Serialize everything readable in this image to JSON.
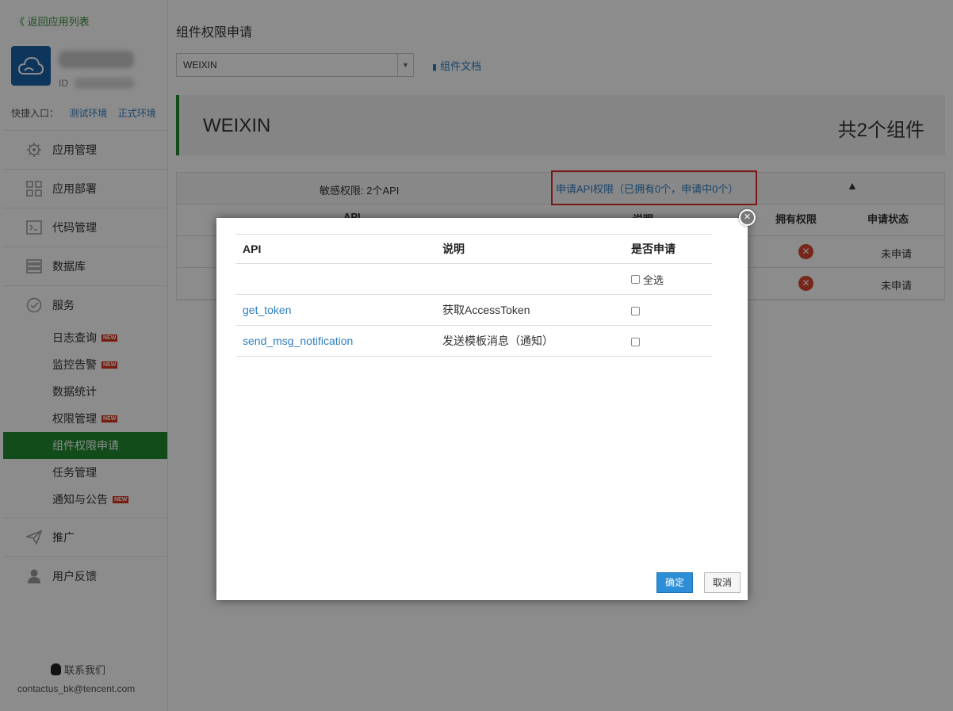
{
  "sidebar": {
    "back_label": "《 返回应用列表",
    "app_id_label": "ID",
    "quick_entry_label": "快捷入口：",
    "quick_links": [
      "测试环境",
      "正式环境"
    ],
    "menu": [
      {
        "label": "应用管理",
        "icon": "gear-icon"
      },
      {
        "label": "应用部署",
        "icon": "grid-icon"
      },
      {
        "label": "代码管理",
        "icon": "terminal-icon"
      },
      {
        "label": "数据库",
        "icon": "database-icon"
      },
      {
        "label": "服务",
        "icon": "check-circle-icon"
      }
    ],
    "service_items": [
      {
        "label": "日志查询",
        "new": true
      },
      {
        "label": "监控告警",
        "new": true
      },
      {
        "label": "数据统计",
        "new": false
      },
      {
        "label": "权限管理",
        "new": true
      },
      {
        "label": "组件权限申请",
        "new": false,
        "active": true
      },
      {
        "label": "任务管理",
        "new": false
      },
      {
        "label": "通知与公告",
        "new": true
      }
    ],
    "menu_bottom": [
      {
        "label": "推广",
        "icon": "paper-plane-icon"
      },
      {
        "label": "用户反馈",
        "icon": "user-icon"
      }
    ],
    "new_badge": "NEW",
    "contact_label": "联系我们",
    "contact_email": "contactus_bk@tencent.com"
  },
  "main": {
    "title": "组件权限申请",
    "select_value": "WEIXIN",
    "doc_link": "组件文档",
    "banner_title": "WEIXIN",
    "banner_count": "共2个组件",
    "sensitive_label": "敏感权限: 2个API",
    "apply_link": "申请API权限（已拥有0个，申请中0个）",
    "columns": {
      "api": "API",
      "desc": "说明",
      "has_perm": "拥有权限",
      "status": "申请状态"
    },
    "rows": [
      {
        "status": "未申请"
      },
      {
        "status": "未申请"
      }
    ]
  },
  "modal": {
    "headers": {
      "api": "API",
      "desc": "说明",
      "apply": "是否申请"
    },
    "select_all": "全选",
    "rows": [
      {
        "api": "get_token",
        "desc": "获取AccessToken"
      },
      {
        "api": "send_msg_notification",
        "desc": "发送模板消息（通知）"
      }
    ],
    "ok_label": "确定",
    "cancel_label": "取消"
  },
  "colors": {
    "accent_green": "#1f8a30",
    "link_blue": "#2f7ec1",
    "highlight_red": "#e02b2b",
    "primary_button": "#2c8ed6"
  }
}
